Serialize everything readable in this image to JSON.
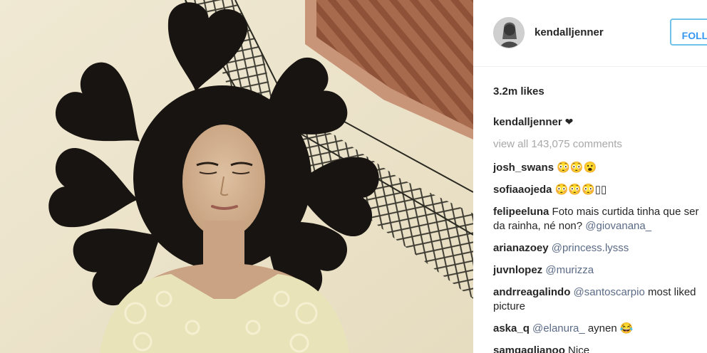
{
  "post": {
    "username": "kendalljenner",
    "follow_label": "FOLLOW",
    "likes": "3.2m likes",
    "caption": {
      "user": "kendalljenner",
      "text": " ❤"
    },
    "view_all_comments": "view all 143,075 comments",
    "comments": [
      {
        "user": "josh_swans",
        "mention": "",
        "text": " 😳😳😮"
      },
      {
        "user": "sofiaaojeda",
        "mention": "",
        "text": " 😳😳😳▯▯"
      },
      {
        "user": "felipeeluna",
        "mention": "@giovanana_",
        "text": " Foto mais curtida tinha que ser da rainha, né non? "
      },
      {
        "user": "arianazoey",
        "mention": "@princess.lysss",
        "text": " "
      },
      {
        "user": "juvnlopez",
        "mention": "@murizza",
        "text": " "
      },
      {
        "user": "andrreagalindo",
        "mention": "@santoscarpio",
        "text": " ",
        "after": " most liked picture"
      },
      {
        "user": "aska_q",
        "mention": "@elanura_",
        "text": " ",
        "after": " aynen 😂"
      },
      {
        "user": "samgaglianoo",
        "mention": "",
        "text": " Nice"
      }
    ]
  },
  "colors": {
    "follow_border": "#70c2e8",
    "follow_text": "#3897f0",
    "mention": "#5b6b86",
    "muted": "#a8a8a8"
  },
  "icons": {
    "avatar": "profile-photo",
    "caption_emoji": "black-heart-icon"
  }
}
